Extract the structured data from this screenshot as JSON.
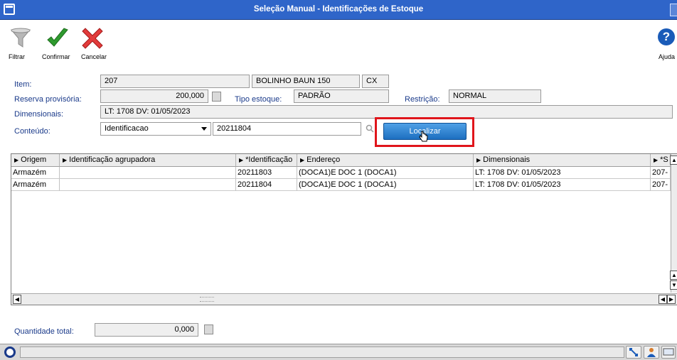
{
  "window": {
    "title": "Seleção Manual - Identificações de Estoque"
  },
  "toolbar": {
    "filter_label": "Filtrar",
    "confirm_label": "Confirmar",
    "cancel_label": "Cancelar",
    "help_label": "Ajuda",
    "help_glyph": "?"
  },
  "form": {
    "item_label": "Item:",
    "item_code": "207",
    "item_desc": "BOLINHO BAUN 150",
    "item_unit": "CX",
    "reserva_label": "Reserva provisória:",
    "reserva_value": "200,000",
    "tipo_label": "Tipo estoque:",
    "tipo_value": "PADRÃO",
    "restricao_label": "Restrição:",
    "restricao_value": "NORMAL",
    "dimensionais_label": "Dimensionais:",
    "dimensionais_value": "LT: 1708 DV: 01/05/2023",
    "conteudo_label": "Conteúdo:",
    "conteudo_select": "Identificacao",
    "conteudo_search": "20211804",
    "localizar_label": "Localizar"
  },
  "grid": {
    "columns": [
      {
        "label": "Origem"
      },
      {
        "label": "Identificação agrupadora"
      },
      {
        "label": "*Identificação"
      },
      {
        "label": "Endereço"
      },
      {
        "label": "Dimensionais"
      },
      {
        "label": "*S"
      }
    ],
    "rows": [
      [
        "Armazém",
        "",
        "20211803",
        "(DOCA1)E DOC 1 (DOCA1)",
        "LT: 1708 DV: 01/05/2023",
        "207-"
      ],
      [
        "Armazém",
        "",
        "20211804",
        "(DOCA1)E DOC 1 (DOCA1)",
        "LT: 1708 DV: 01/05/2023",
        "207-"
      ]
    ]
  },
  "footer": {
    "quantidade_label": "Quantidade total:",
    "quantidade_value": "0,000"
  },
  "colors": {
    "titlebar": "#2f65c9",
    "highlight": "#e0151b",
    "localizar_button": "#1d6fc0"
  }
}
